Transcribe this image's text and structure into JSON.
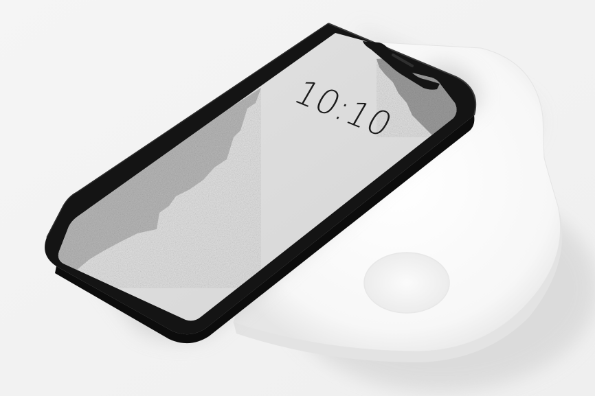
{
  "phone": {
    "lock_screen": {
      "time": "10:10"
    }
  },
  "colors": {
    "background": "#f2f2f2",
    "phone_frame": "#161616",
    "screen": "#dcdcdc",
    "torn_paper_texture": "#b9b9b9",
    "charger_pad": "#ffffff",
    "shadow": "#d9d9d9"
  },
  "objects": [
    "smartphone",
    "wireless-charging-pad"
  ]
}
